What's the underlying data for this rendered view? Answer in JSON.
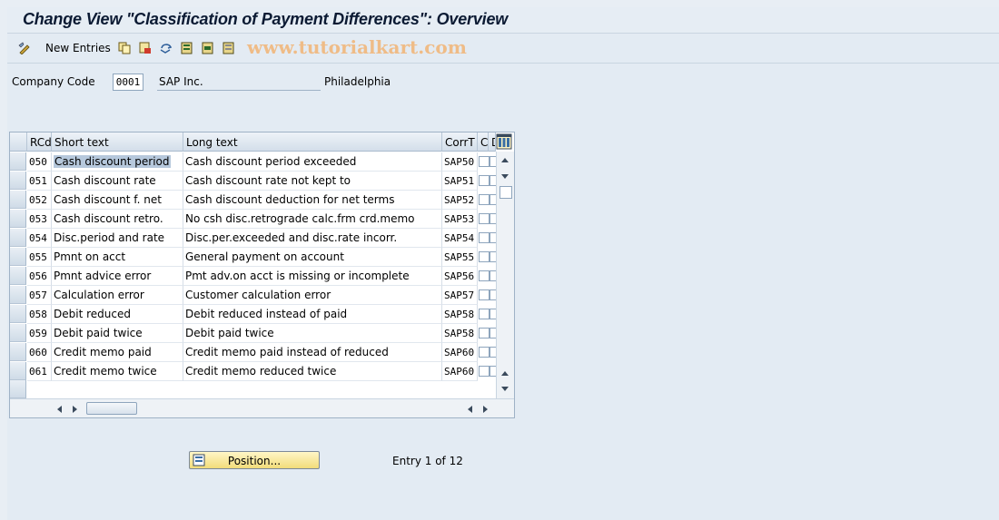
{
  "title": "Change View \"Classification of Payment Differences\": Overview",
  "toolbar": {
    "new_entries_label": "New Entries",
    "watermark": "www.tutorialkart.com"
  },
  "header": {
    "company_code_label": "Company Code",
    "company_code_value": "0001",
    "company_name": "SAP Inc.",
    "city": "Philadelphia"
  },
  "table": {
    "headers": {
      "rcd": "RCd",
      "short": "Short text",
      "long": "Long text",
      "corrt": "CorrT",
      "c": "C",
      "d": "D"
    },
    "rows": [
      {
        "rcd": "050",
        "short": "Cash discount period",
        "long": "Cash discount period exceeded",
        "corrt": "SAP50"
      },
      {
        "rcd": "051",
        "short": "Cash discount rate",
        "long": "Cash discount rate not kept to",
        "corrt": "SAP51"
      },
      {
        "rcd": "052",
        "short": "Cash discount f. net",
        "long": "Cash discount deduction for net terms",
        "corrt": "SAP52"
      },
      {
        "rcd": "053",
        "short": "Cash discount retro.",
        "long": "No csh disc.retrograde calc.frm crd.memo",
        "corrt": "SAP53"
      },
      {
        "rcd": "054",
        "short": "Disc.period and rate",
        "long": "Disc.per.exceeded and disc.rate incorr.",
        "corrt": "SAP54"
      },
      {
        "rcd": "055",
        "short": "Pmnt on acct",
        "long": "General payment on account",
        "corrt": "SAP55"
      },
      {
        "rcd": "056",
        "short": "Pmnt advice error",
        "long": "Pmt adv.on acct is missing or incomplete",
        "corrt": "SAP56"
      },
      {
        "rcd": "057",
        "short": "Calculation error",
        "long": "Customer calculation error",
        "corrt": "SAP57"
      },
      {
        "rcd": "058",
        "short": "Debit reduced",
        "long": "Debit reduced instead of paid",
        "corrt": "SAP58"
      },
      {
        "rcd": "059",
        "short": "Debit paid twice",
        "long": "Debit paid twice",
        "corrt": "SAP58"
      },
      {
        "rcd": "060",
        "short": "Credit memo paid",
        "long": "Credit memo paid instead of reduced",
        "corrt": "SAP60"
      },
      {
        "rcd": "061",
        "short": "Credit memo twice",
        "long": "Credit memo reduced twice",
        "corrt": "SAP60"
      }
    ]
  },
  "footer": {
    "position_label": "Position...",
    "entry_text": "Entry 1 of 12"
  }
}
